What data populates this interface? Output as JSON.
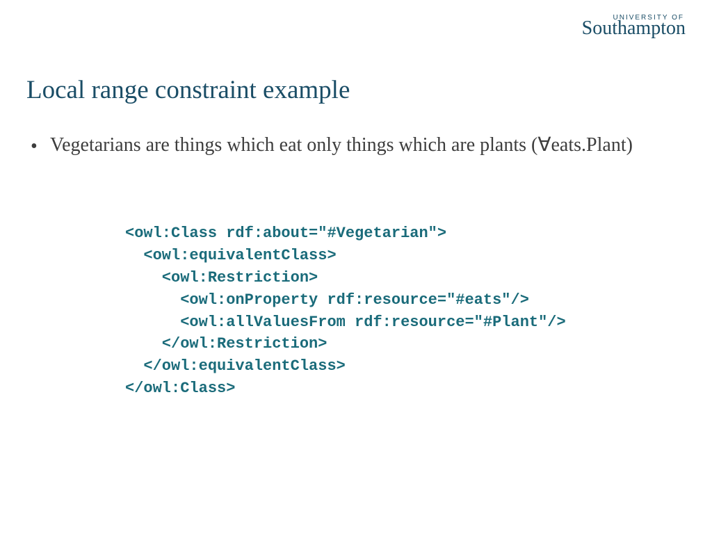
{
  "logo": {
    "top": "UNIVERSITY OF",
    "main": "Southampton"
  },
  "title": "Local range constraint example",
  "bullet": {
    "marker": "•",
    "text": "Vegetarians are things which eat only things which are plants (∀eats.Plant)"
  },
  "code": {
    "l1": "<owl:Class rdf:about=\"#Vegetarian\">",
    "l2": "  <owl:equivalentClass>",
    "l3": "    <owl:Restriction>",
    "l4": "      <owl:onProperty rdf:resource=\"#eats\"/>",
    "l5": "      <owl:allValuesFrom rdf:resource=\"#Plant\"/>",
    "l6": "    </owl:Restriction>",
    "l7": "  </owl:equivalentClass>",
    "l8": "</owl:Class>"
  }
}
